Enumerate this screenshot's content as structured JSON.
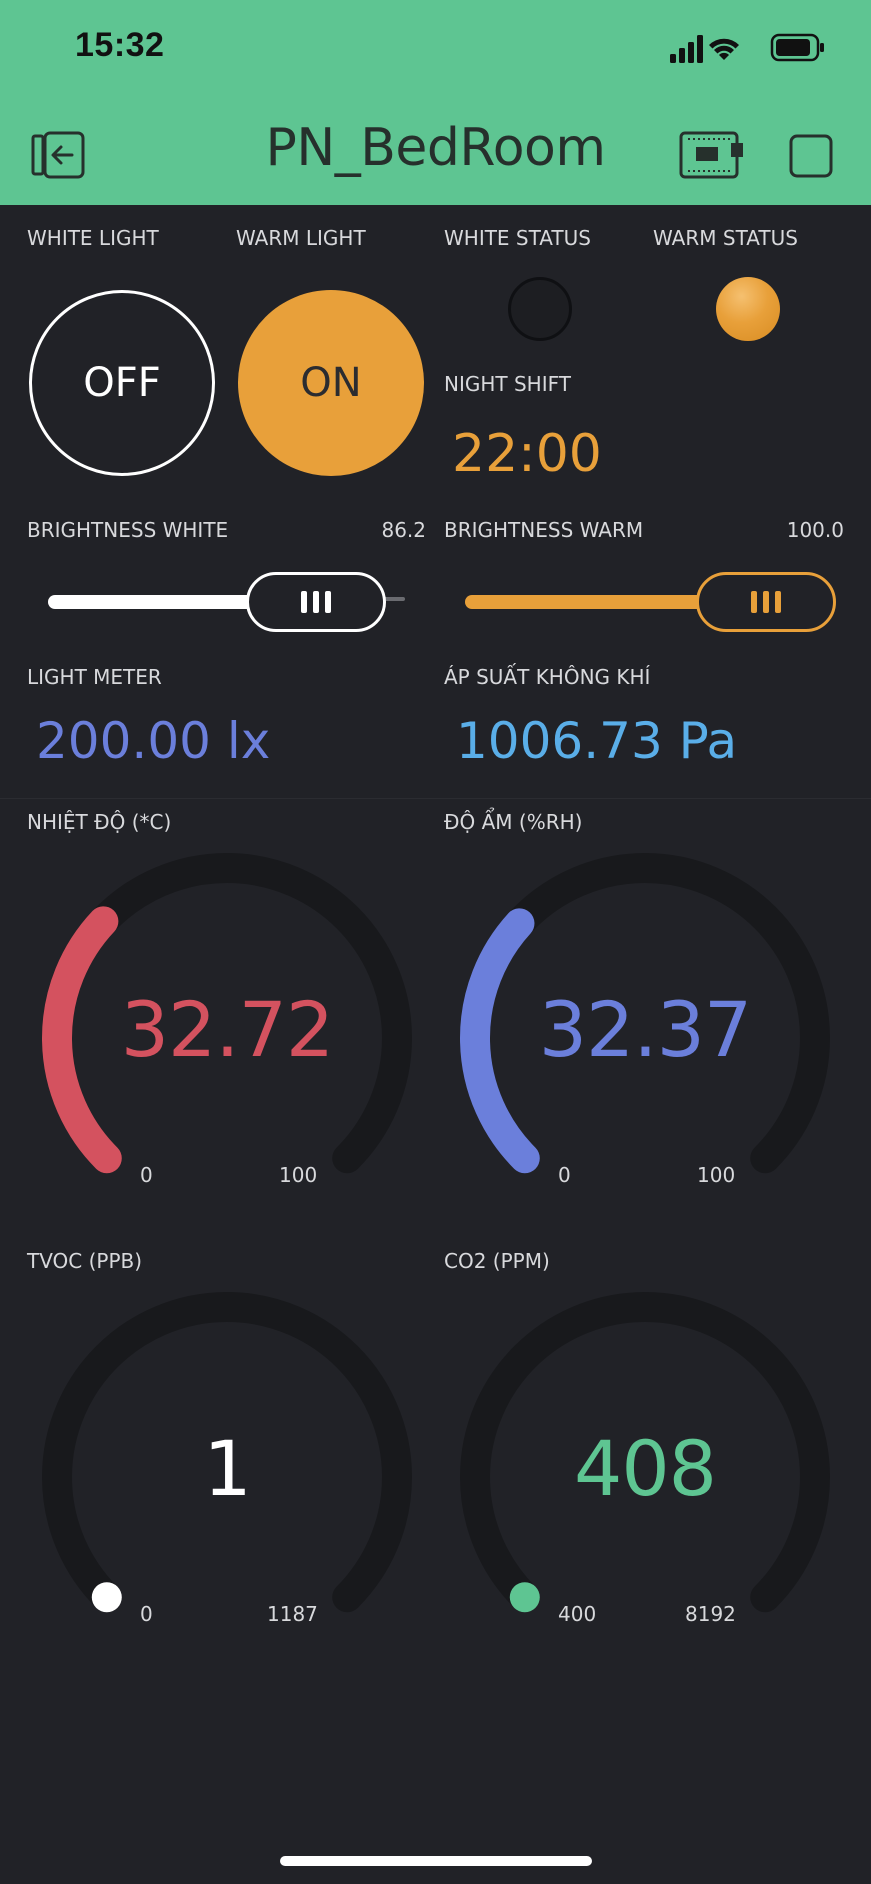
{
  "status_bar": {
    "time": "15:32"
  },
  "header": {
    "title": "PN_BedRoom",
    "exit_icon": "exit-icon",
    "device_icon": "device-board-icon",
    "window_icon": "square-icon"
  },
  "labels": {
    "white_light": "WHITE LIGHT",
    "warm_light": "WARM LIGHT",
    "white_status": "WHITE STATUS",
    "warm_status": "WARM STATUS",
    "night_shift": "NIGHT SHIFT",
    "brightness_white": "BRIGHTNESS WHITE",
    "brightness_warm": "BRIGHTNESS WARM",
    "light_meter": "LIGHT METER",
    "air_pressure": "ÁP SUẤT KHÔNG KHÍ",
    "temperature": "NHIỆT ĐỘ (*C)",
    "humidity": "ĐỘ ẨM (%RH)",
    "tvoc": "TVOC (PPB)",
    "co2": "CO2 (PPM)"
  },
  "buttons": {
    "white_light": "OFF",
    "warm_light": "ON"
  },
  "status": {
    "white": "off",
    "warm": "on"
  },
  "night_shift": {
    "value": "22:00"
  },
  "sliders": {
    "white": {
      "value_text": "86.2",
      "fraction": 0.862,
      "color": "#ffffff"
    },
    "warm": {
      "value_text": "100.0",
      "fraction": 1.0,
      "color": "#e8a03a"
    }
  },
  "readings": {
    "light_meter": "200.00 lx",
    "air_pressure": "1006.73 Pa"
  },
  "gauges": {
    "temperature": {
      "value": "32.72",
      "min": "0",
      "max": "100",
      "fraction": 0.3272,
      "color": "#d4525f"
    },
    "humidity": {
      "value": "32.37",
      "min": "0",
      "max": "100",
      "fraction": 0.3237,
      "color": "#6b7fdb"
    },
    "tvoc": {
      "value": "1",
      "min": "0",
      "max": "1187",
      "fraction": 0.0,
      "color": "#ffffff"
    },
    "co2": {
      "value": "408",
      "min": "400",
      "max": "8192",
      "fraction": 0.001,
      "color": "#5ec592"
    }
  },
  "colors": {
    "header_bg": "#5ec592",
    "page_bg": "#212227",
    "accent_warm": "#e8a03a",
    "light_meter": "#6b7fdb",
    "air_pressure": "#5aaee8"
  }
}
